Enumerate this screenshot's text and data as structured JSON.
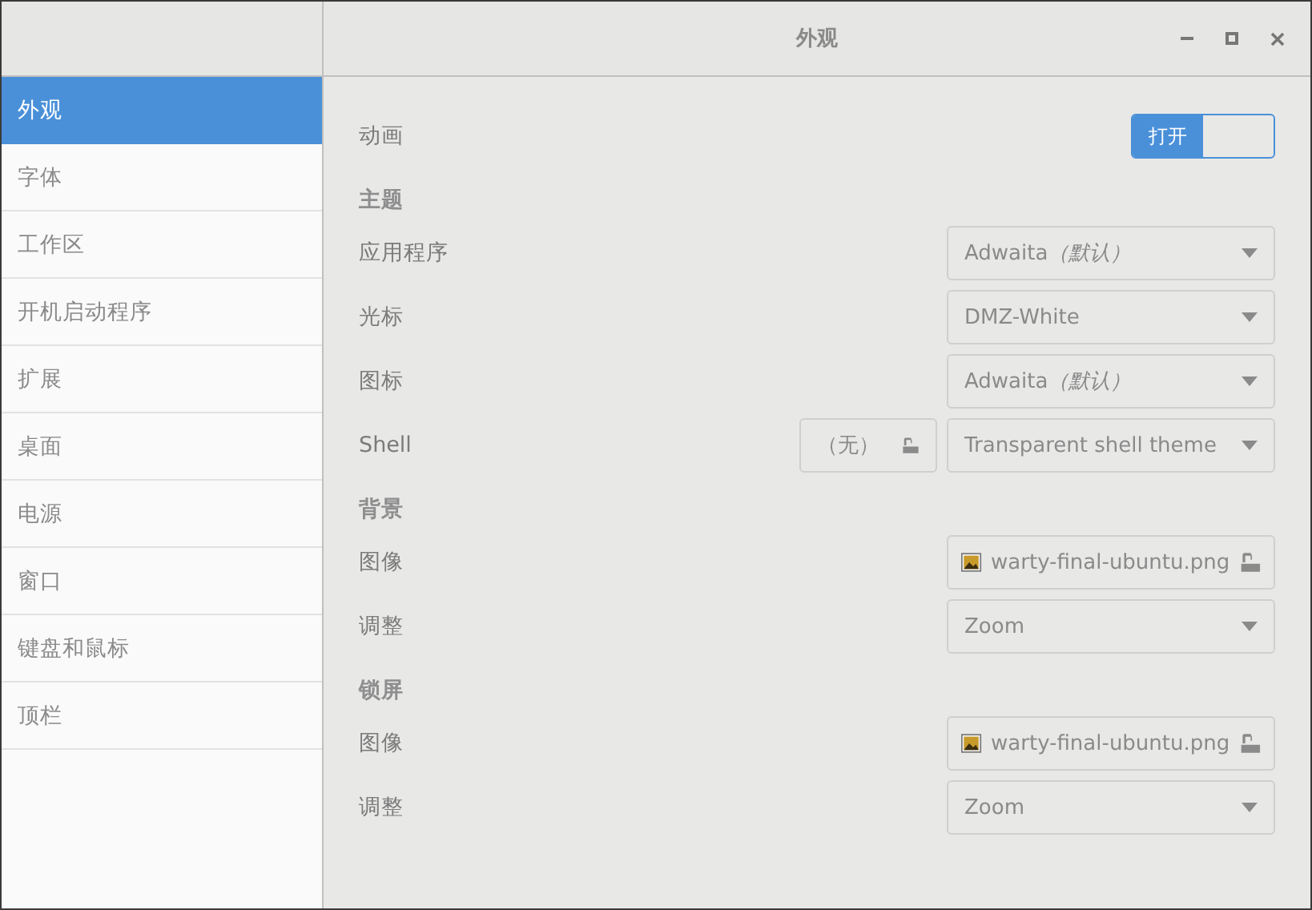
{
  "window": {
    "title": "外观"
  },
  "sidebar": {
    "items": [
      {
        "label": "外观",
        "selected": true
      },
      {
        "label": "字体",
        "selected": false
      },
      {
        "label": "工作区",
        "selected": false
      },
      {
        "label": "开机启动程序",
        "selected": false
      },
      {
        "label": "扩展",
        "selected": false
      },
      {
        "label": "桌面",
        "selected": false
      },
      {
        "label": "电源",
        "selected": false
      },
      {
        "label": "窗口",
        "selected": false
      },
      {
        "label": "键盘和鼠标",
        "selected": false
      },
      {
        "label": "顶栏",
        "selected": false
      }
    ]
  },
  "settings": [
    {
      "kind": "switch",
      "label": "动画",
      "state_label": "打开",
      "on": true
    },
    {
      "kind": "heading",
      "label": "主题"
    },
    {
      "kind": "combo",
      "label": "应用程序",
      "value": "Adwaita",
      "note": "（默认）"
    },
    {
      "kind": "combo",
      "label": "光标",
      "value": "DMZ-White"
    },
    {
      "kind": "combo",
      "label": "图标",
      "value": "Adwaita",
      "note": "（默认）"
    },
    {
      "kind": "shell",
      "label": "Shell",
      "file_value": "（无）",
      "value": "Transparent shell theme"
    },
    {
      "kind": "heading",
      "label": "背景"
    },
    {
      "kind": "file",
      "label": "图像",
      "value": "warty-final-ubuntu.png"
    },
    {
      "kind": "combo",
      "label": "调整",
      "value": "Zoom"
    },
    {
      "kind": "heading",
      "label": "锁屏"
    },
    {
      "kind": "file",
      "label": "图像",
      "value": "warty-final-ubuntu.png"
    },
    {
      "kind": "combo",
      "label": "调整",
      "value": "Zoom"
    }
  ]
}
